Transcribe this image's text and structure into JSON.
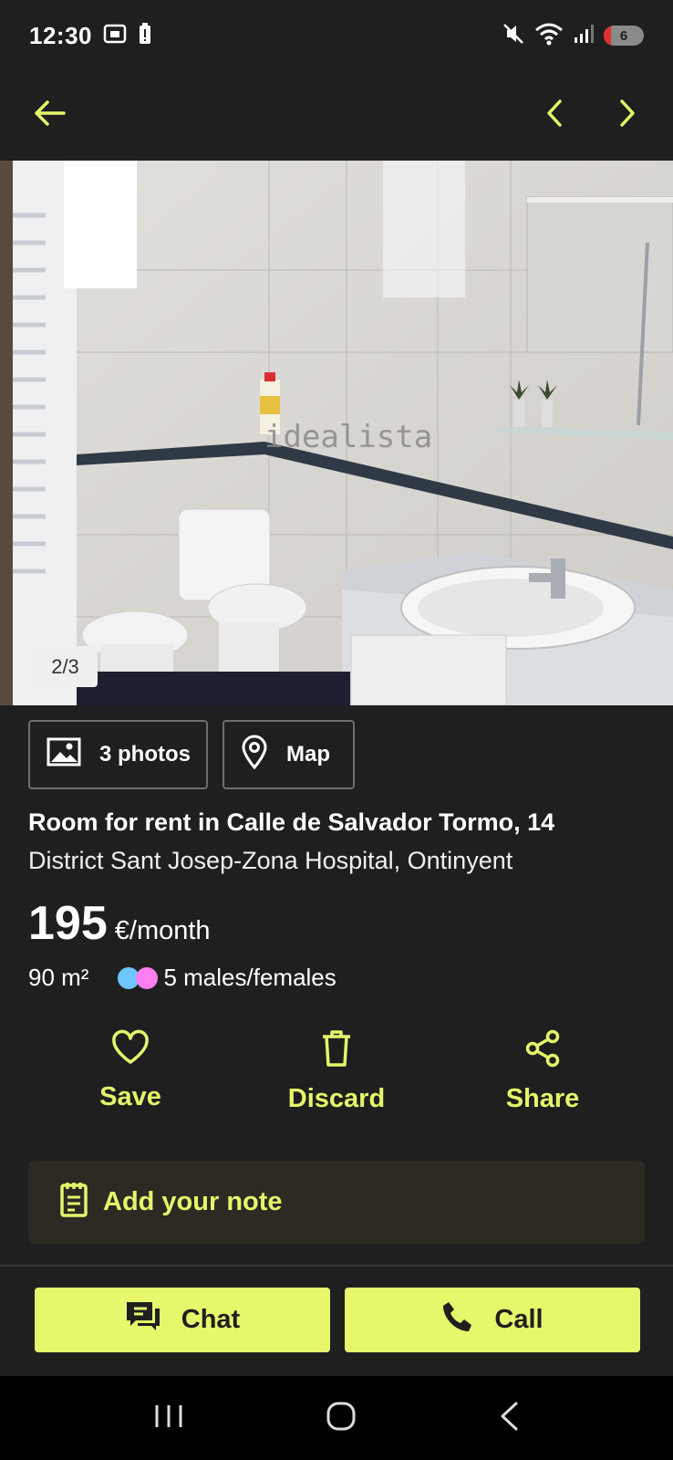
{
  "status_bar": {
    "time": "12:30",
    "battery_level": "6",
    "icons": [
      "screenshot-icon",
      "battery-alert-icon",
      "mute-icon",
      "wifi-icon",
      "signal-icon"
    ]
  },
  "nav": {
    "icons": [
      "back-arrow-icon",
      "previous-chevron-icon",
      "next-chevron-icon"
    ]
  },
  "gallery": {
    "counter": "2/3",
    "watermark": "idealista"
  },
  "media": {
    "photos_label": "3 photos",
    "map_label": "Map"
  },
  "listing": {
    "title": "Room for rent in Calle de Salvador Tormo, 14",
    "subtitle": "District Sant Josep-Zona Hospital, Ontinyent",
    "price": "195",
    "price_unit": "€/month",
    "area": "90 m²",
    "occupants": "5 males/females"
  },
  "actions": {
    "save": "Save",
    "discard": "Discard",
    "share": "Share"
  },
  "note": {
    "label": "Add your note"
  },
  "cta": {
    "chat": "Chat",
    "call": "Call"
  },
  "colors": {
    "background": "#1f1f1f",
    "accent": "#e5f56b",
    "note_background": "#2c2a22",
    "male_dot": "#6ec6ff",
    "female_dot": "#ff7ef2"
  }
}
